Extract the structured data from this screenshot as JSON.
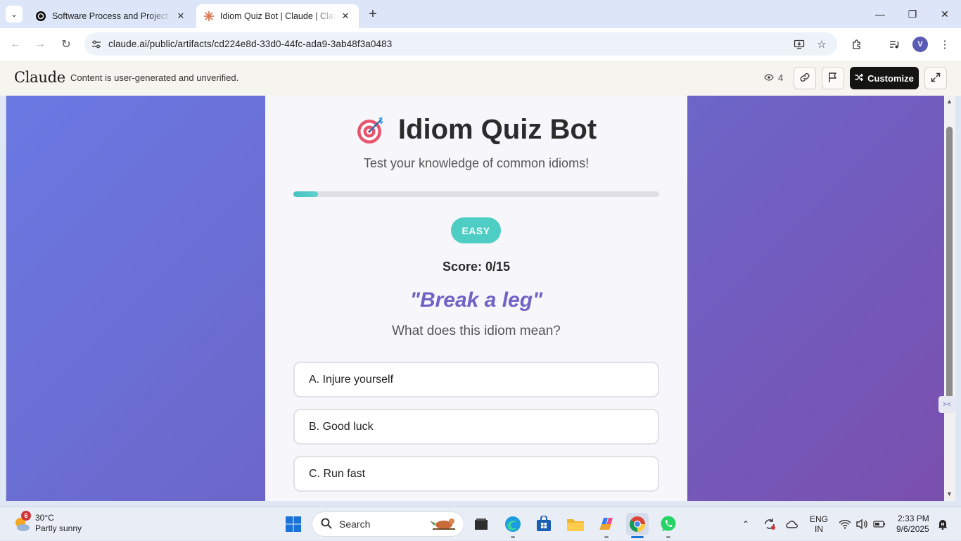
{
  "browser": {
    "tabs": [
      {
        "title": "Software Process and Project M",
        "active": false,
        "favicon": "openai-icon"
      },
      {
        "title": "Idiom Quiz Bot | Claude | Claude",
        "active": true,
        "favicon": "claude-icon"
      }
    ],
    "url": "claude.ai/public/artifacts/cd224e8d-33d0-44fc-ada9-3ab48f3a0483",
    "profile_initial": "V"
  },
  "claude_header": {
    "logo": "Claude",
    "notice": "Content is user-generated and unverified.",
    "views": "4",
    "customize_label": "Customize"
  },
  "quiz": {
    "title": "Idiom Quiz Bot",
    "subtitle": "Test your knowledge of common idioms!",
    "progress": 0.0667,
    "difficulty": "EASY",
    "score": "Score: 0/15",
    "idiom": "\"Break a leg\"",
    "question": "What does this idiom mean?",
    "options": [
      "A. Injure yourself",
      "B. Good luck",
      "C. Run fast"
    ]
  },
  "taskbar": {
    "weather_temp": "30°C",
    "weather_desc": "Partly sunny",
    "weather_badge": "6",
    "search_label": "Search",
    "lang_line1": "ENG",
    "lang_line2": "IN",
    "time": "2:33 PM",
    "date": "9/6/2025"
  },
  "colors": {
    "accent_purple": "#6f63c5",
    "teal": "#4ecdc4",
    "gradient_start": "#6a79e2",
    "gradient_end": "#7a4fae"
  }
}
